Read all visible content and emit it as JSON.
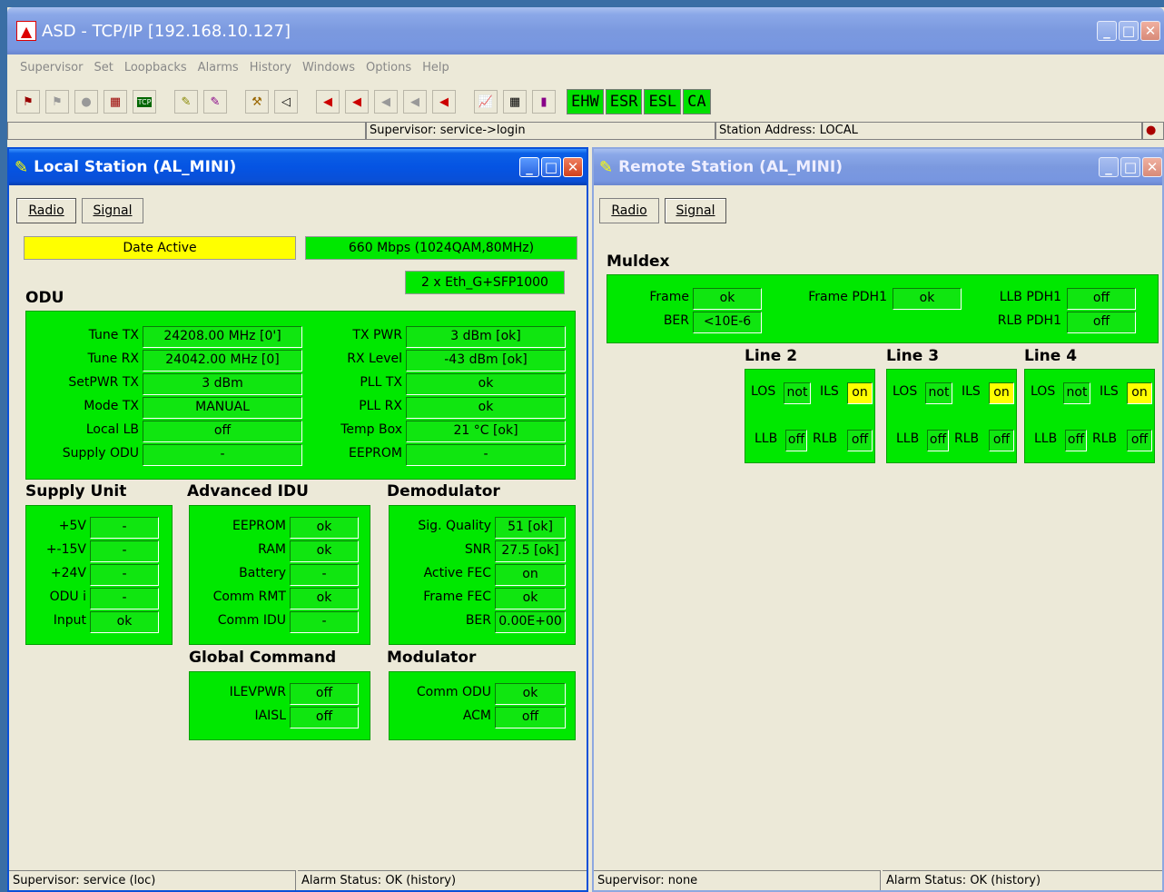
{
  "app": {
    "title": "ASD - TCP/IP [192.168.10.127]",
    "menu": [
      "Supervisor",
      "Set",
      "Loopbacks",
      "Alarms",
      "History",
      "Windows",
      "Options",
      "Help"
    ],
    "status_tags": [
      "EHW",
      "ESR",
      "ESL",
      "CA"
    ],
    "supervisor_status": "Supervisor: service->login",
    "station_address": "Station Address: LOCAL"
  },
  "local": {
    "title": "Local Station (AL_MINI)",
    "tabs": {
      "radio": "Radio",
      "signal": "Signal"
    },
    "date_active": "Date Active",
    "rate": "660 Mbps (1024QAM,80MHz)",
    "eth": "2 x Eth_G+SFP1000",
    "odu": {
      "heading": "ODU",
      "left": [
        {
          "label": "Tune TX",
          "value": "24208.00 MHz  [0']"
        },
        {
          "label": "Tune RX",
          "value": "24042.00 MHz  [0]"
        },
        {
          "label": "SetPWR TX",
          "value": "3 dBm"
        },
        {
          "label": "Mode TX",
          "value": "MANUAL"
        },
        {
          "label": "Local LB",
          "value": "off"
        },
        {
          "label": "Supply ODU",
          "value": "-"
        }
      ],
      "right": [
        {
          "label": "TX PWR",
          "value": "3 dBm [ok]"
        },
        {
          "label": "RX Level",
          "value": "-43 dBm [ok]"
        },
        {
          "label": "PLL TX",
          "value": "ok"
        },
        {
          "label": "PLL RX",
          "value": "ok"
        },
        {
          "label": "Temp Box",
          "value": "21 °C [ok]"
        },
        {
          "label": "EEPROM",
          "value": "-"
        }
      ]
    },
    "supply": {
      "heading": "Supply Unit",
      "rows": [
        {
          "label": "+5V",
          "value": "-"
        },
        {
          "label": "+-15V",
          "value": "-"
        },
        {
          "label": "+24V",
          "value": "-"
        },
        {
          "label": "ODU  i",
          "value": "-"
        },
        {
          "label": "Input",
          "value": "ok"
        }
      ]
    },
    "adv_idu": {
      "heading": "Advanced IDU",
      "rows": [
        {
          "label": "EEPROM",
          "value": "ok"
        },
        {
          "label": "RAM",
          "value": "ok"
        },
        {
          "label": "Battery",
          "value": "-"
        },
        {
          "label": "Comm RMT",
          "value": "ok"
        },
        {
          "label": "Comm IDU",
          "value": "-"
        }
      ]
    },
    "demod": {
      "heading": "Demodulator",
      "rows": [
        {
          "label": "Sig. Quality",
          "value": "51 [ok]"
        },
        {
          "label": "SNR",
          "value": "27.5 [ok]"
        },
        {
          "label": "Active FEC",
          "value": "on"
        },
        {
          "label": "Frame FEC",
          "value": "ok"
        },
        {
          "label": "BER",
          "value": "0.00E+00"
        }
      ]
    },
    "global": {
      "heading": "Global Command",
      "rows": [
        {
          "label": "ILEVPWR",
          "value": "off"
        },
        {
          "label": "IAISL",
          "value": "off"
        }
      ]
    },
    "mod": {
      "heading": "Modulator",
      "rows": [
        {
          "label": "Comm ODU",
          "value": "ok"
        },
        {
          "label": "ACM",
          "value": "off"
        }
      ]
    },
    "status_left": "Supervisor: service (loc)",
    "status_right": "Alarm Status: OK (history)"
  },
  "remote": {
    "title": "Remote Station (AL_MINI)",
    "tabs": {
      "radio": "Radio",
      "signal": "Signal"
    },
    "muldex": {
      "heading": "Muldex",
      "frame_label": "Frame",
      "frame_value": "ok",
      "ber_label": "BER",
      "ber_value": "<10E-6",
      "frame_pdh_label": "Frame PDH1",
      "frame_pdh_value": "ok",
      "llb_label": "LLB PDH1",
      "llb_value": "off",
      "rlb_label": "RLB PDH1",
      "rlb_value": "off"
    },
    "lines": [
      {
        "heading": "Line 2",
        "los": "LOS",
        "los_v": "not",
        "ils": "ILS",
        "ils_v": "on",
        "llb": "LLB",
        "llb_v": "off",
        "rlb": "RLB",
        "rlb_v": "off"
      },
      {
        "heading": "Line 3",
        "los": "LOS",
        "los_v": "not",
        "ils": "ILS",
        "ils_v": "on",
        "llb": "LLB",
        "llb_v": "off",
        "rlb": "RLB",
        "rlb_v": "off"
      },
      {
        "heading": "Line 4",
        "los": "LOS",
        "los_v": "not",
        "ils": "ILS",
        "ils_v": "on",
        "llb": "LLB",
        "llb_v": "off",
        "rlb": "RLB",
        "rlb_v": "off"
      }
    ],
    "status_left": "Supervisor: none",
    "status_right": "Alarm Status: OK (history)"
  }
}
